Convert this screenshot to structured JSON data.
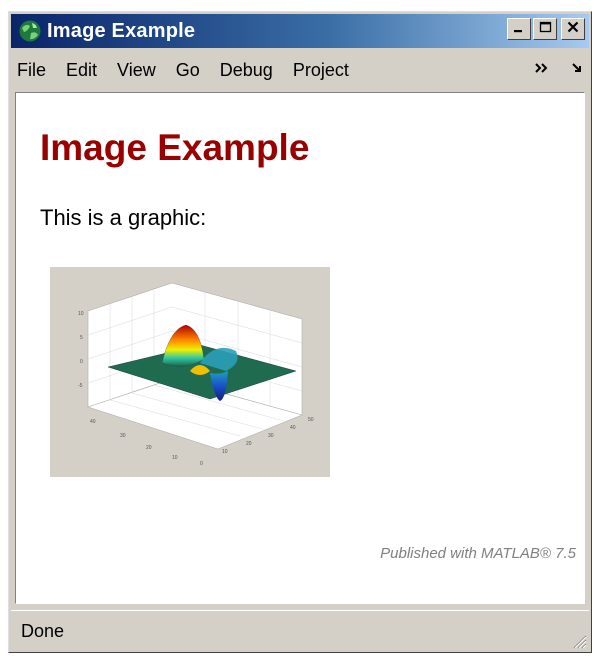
{
  "window": {
    "title": "Image Example",
    "controls": {
      "minimize": "_",
      "maximize": "□",
      "close": "×"
    }
  },
  "menubar": {
    "items": [
      "File",
      "Edit",
      "View",
      "Go",
      "Debug",
      "Project"
    ],
    "overflow_icon": "chevron-double-right-icon",
    "dock_icon": "undock-arrow-icon"
  },
  "content": {
    "heading": "Image Example",
    "paragraph": "This is a graphic:",
    "figure_icon": "surface-plot-image",
    "footer": "Published with MATLAB® 7.5"
  },
  "statusbar": {
    "text": "Done"
  },
  "colors": {
    "heading": "#990000",
    "titlebar_start": "#0a246a",
    "titlebar_end": "#a6caf0",
    "chrome": "#d4d0c8"
  }
}
